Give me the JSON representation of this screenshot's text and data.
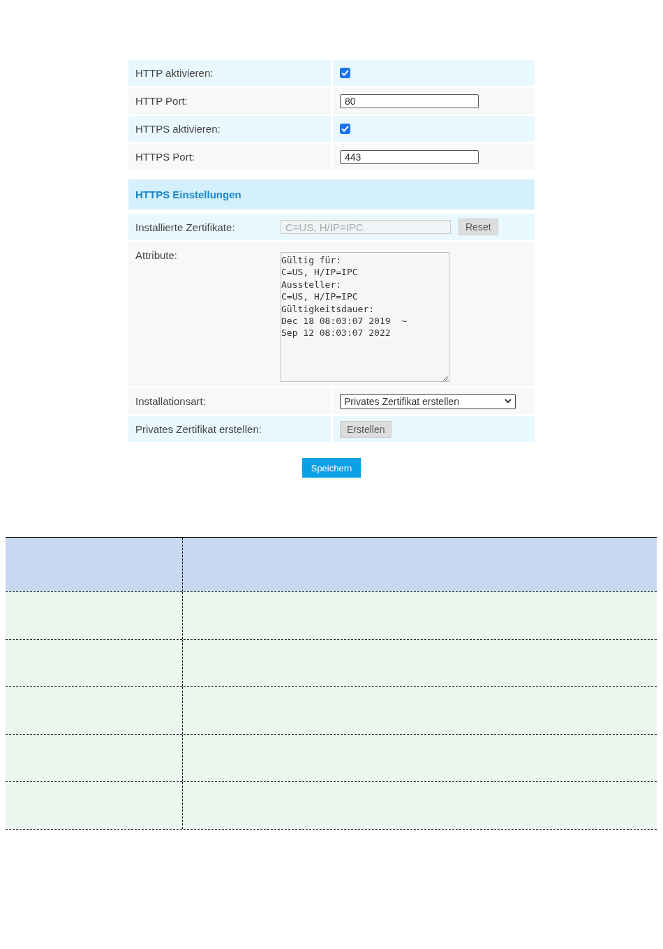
{
  "settings": [
    {
      "kind": "checkbox",
      "label": "HTTP aktivieren:",
      "checked": true
    },
    {
      "kind": "text",
      "label": "HTTP Port:",
      "value": "80"
    },
    {
      "kind": "checkbox",
      "label": "HTTPS aktivieren:",
      "checked": true
    },
    {
      "kind": "text",
      "label": "HTTPS Port:",
      "value": "443"
    }
  ],
  "https_section": {
    "title": "HTTPS Einstellungen",
    "rows": [
      {
        "kind": "certificate",
        "label": "Installierte Zertifikate:",
        "value": "C=US, H/IP=IPC",
        "button": "Reset"
      },
      {
        "kind": "textarea",
        "label": "Attribute:",
        "lines": [
          "Gültig für:",
          "C=US, H/IP=IPC",
          "Aussteller:",
          "C=US, H/IP=IPC",
          "Gültigkeitsdauer:",
          "Dec 18 08:03:07 2019  ~",
          "Sep 12 08:03:07 2022"
        ]
      },
      {
        "kind": "select",
        "label": "Installationsart:",
        "value": "Privates Zertifikat erstellen"
      },
      {
        "kind": "button",
        "label": "Privates Zertifikat erstellen:",
        "button": "Erstellen"
      }
    ]
  },
  "save_button": "Speichern",
  "table": {
    "rows": [
      {
        "kind": "header"
      },
      {
        "kind": "body"
      },
      {
        "kind": "body"
      },
      {
        "kind": "body"
      },
      {
        "kind": "body"
      },
      {
        "kind": "body"
      }
    ]
  }
}
